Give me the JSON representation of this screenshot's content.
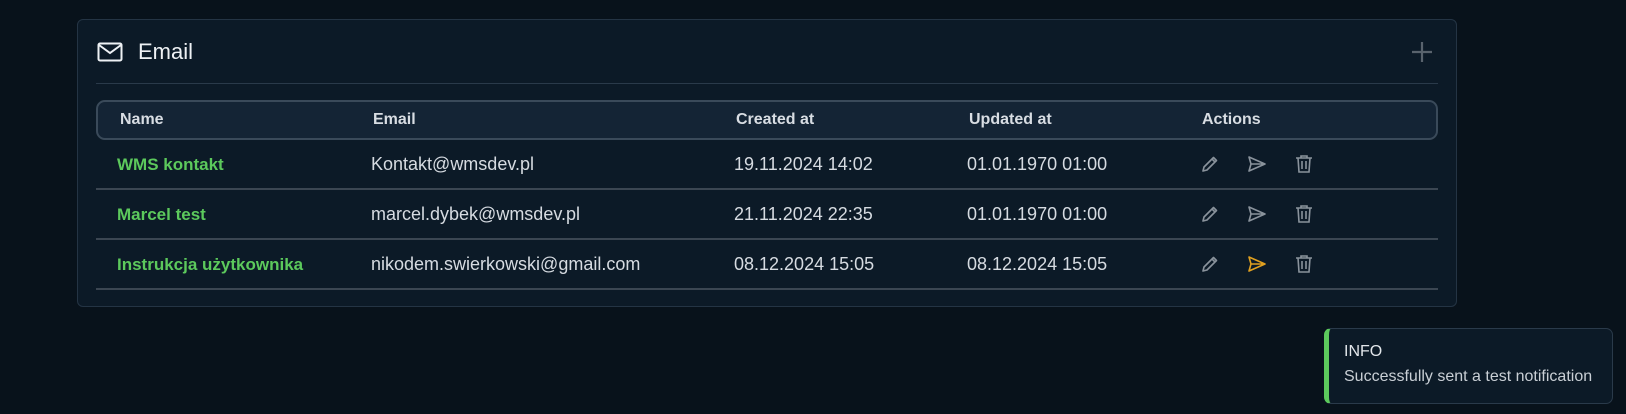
{
  "card": {
    "title": "Email",
    "icon": "mail-icon",
    "add_icon": "plus-icon"
  },
  "table": {
    "headers": [
      "Name",
      "Email",
      "Created at",
      "Updated at",
      "Actions"
    ],
    "rows": [
      {
        "name": "WMS kontakt",
        "email": "Kontakt@wmsdev.pl",
        "created": "19.11.2024 14:02",
        "updated": "01.01.1970 01:00",
        "send_active": false
      },
      {
        "name": "Marcel test",
        "email": "marcel.dybek@wmsdev.pl",
        "created": "21.11.2024 22:35",
        "updated": "01.01.1970 01:00",
        "send_active": false
      },
      {
        "name": "Instrukcja użytkownika",
        "email": "nikodem.swierkowski@gmail.com",
        "created": "08.12.2024 15:05",
        "updated": "08.12.2024 15:05",
        "send_active": true
      }
    ],
    "action_icons": [
      "pencil-icon",
      "send-icon",
      "trash-icon"
    ]
  },
  "toast": {
    "title": "INFO",
    "message": "Successfully sent a test notification",
    "accent": "#5cc95c"
  },
  "colors": {
    "name_link": "#5cc95c",
    "send_active": "#e0a020",
    "icon_default": "#8a939c"
  }
}
